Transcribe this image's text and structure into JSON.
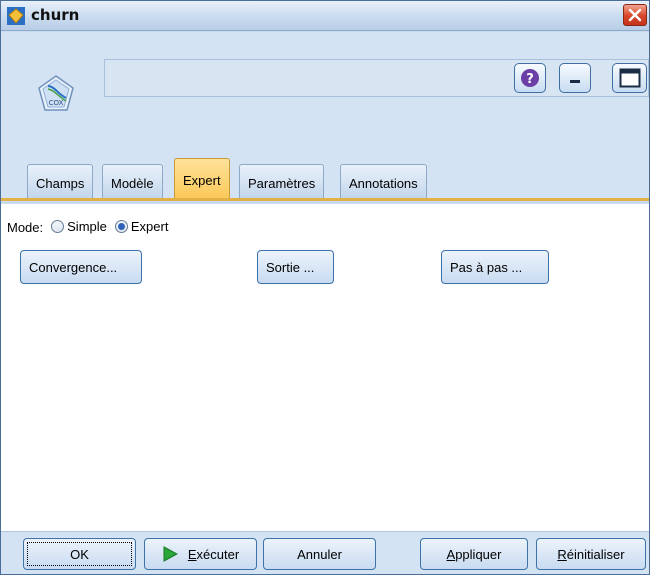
{
  "window": {
    "title": "churn"
  },
  "node": {
    "icon_label": "COX"
  },
  "toolbar": {
    "help_icon": "question-icon",
    "minimize_icon": "minimize-icon",
    "maximize_icon": "maximize-icon"
  },
  "tabs": [
    {
      "label": "Champs"
    },
    {
      "label": "Modèle"
    },
    {
      "label": "Expert",
      "active": true
    },
    {
      "label": "Paramètres"
    },
    {
      "label": "Annotations"
    }
  ],
  "mode": {
    "label": "Mode:",
    "options": [
      "Simple",
      "Expert"
    ],
    "selected": "Expert"
  },
  "buttons": {
    "convergence": "Convergence...",
    "sortie": "Sortie ...",
    "pas_a_pas": "Pas à pas ..."
  },
  "footer": {
    "ok": "OK",
    "executer_first": "E",
    "executer_rest": "xécuter",
    "annuler": "Annuler",
    "appliquer_first": "A",
    "appliquer_rest": "ppliquer",
    "reinit_first": "R",
    "reinit_rest": "éinitialiser"
  },
  "colors": {
    "accent_tab": "#fbc95a",
    "window_bg": "#d4e3f3",
    "border_blue": "#3f72a8"
  }
}
